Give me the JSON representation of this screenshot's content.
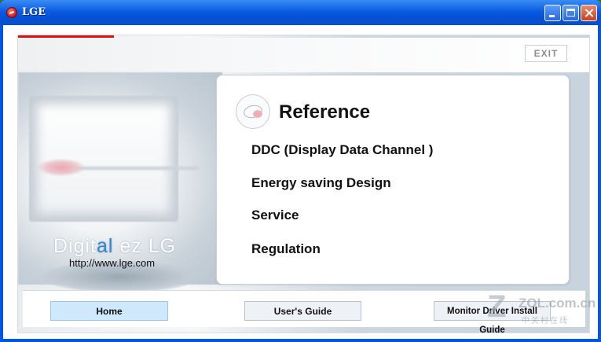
{
  "window": {
    "title": "LGE",
    "colors": {
      "titlebar": "#0a5ce3",
      "close": "#c9401f"
    }
  },
  "header": {
    "exit_label": "EXIT"
  },
  "brand": {
    "text_before": "Digit",
    "text_accent": "al",
    "text_after": " ez LG",
    "url": "http://www.lge.com",
    "accent_color": "#2f86d6",
    "red_bar_color": "#e01010"
  },
  "reference": {
    "title": "Reference",
    "icon": "lg-logo-icon",
    "links": [
      "DDC (Display Data Channel )",
      "Energy saving Design",
      "Service",
      "Regulation"
    ]
  },
  "bottom_nav": {
    "home": "Home",
    "users_guide": "User's Guide",
    "driver_guide": "Monitor Driver Install Guide"
  },
  "watermark": {
    "site": "ZOL.com.cn",
    "cn": "中关村在线"
  }
}
